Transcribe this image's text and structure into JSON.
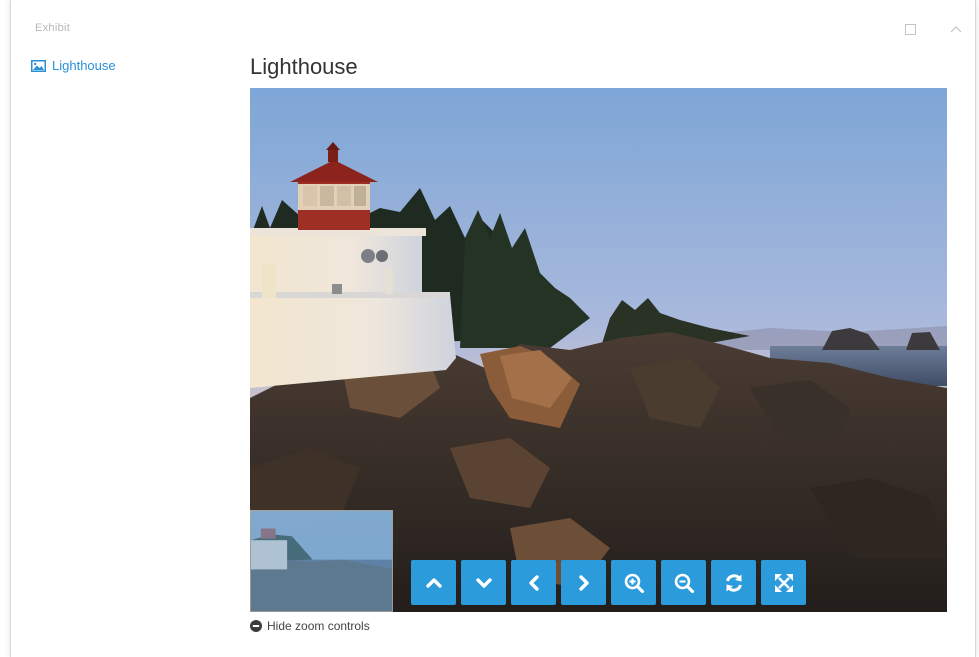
{
  "window": {
    "title": "Exhibit"
  },
  "sidebar": {
    "items": [
      {
        "label": "Lighthouse",
        "icon": "image-icon"
      }
    ]
  },
  "main": {
    "title": "Lighthouse"
  },
  "viewer": {
    "image_alt": "Lighthouse",
    "zoom_controls": [
      {
        "name": "pan-up-button",
        "icon": "chevron-up-icon"
      },
      {
        "name": "pan-down-button",
        "icon": "chevron-down-icon"
      },
      {
        "name": "pan-left-button",
        "icon": "chevron-left-icon"
      },
      {
        "name": "pan-right-button",
        "icon": "chevron-right-icon"
      },
      {
        "name": "zoom-in-button",
        "icon": "zoom-in-icon"
      },
      {
        "name": "zoom-out-button",
        "icon": "zoom-out-icon"
      },
      {
        "name": "reset-button",
        "icon": "refresh-icon"
      },
      {
        "name": "fullscreen-button",
        "icon": "fullscreen-icon"
      }
    ],
    "hide_zoom_label": "Hide zoom controls"
  },
  "colors": {
    "accent": "#2b9bdb",
    "link": "#2b8fd8"
  }
}
